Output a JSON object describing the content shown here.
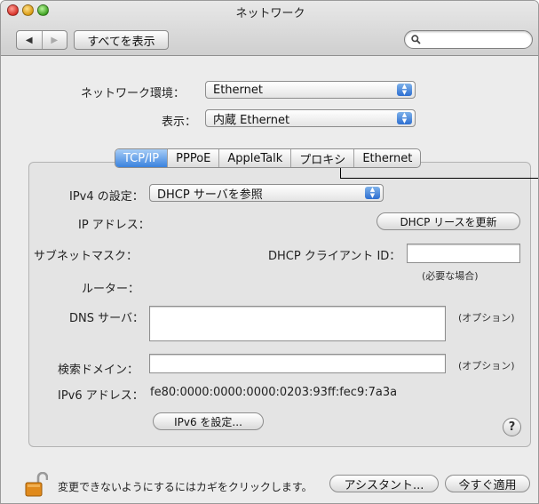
{
  "window": {
    "title": "ネットワーク"
  },
  "toolbar": {
    "back_label": "◀",
    "forward_label": "▶",
    "show_all_label": "すべてを表示",
    "search_placeholder": ""
  },
  "location": {
    "label": "ネットワーク環境：",
    "value": "Ethernet"
  },
  "show": {
    "label": "表示：",
    "value": "内蔵 Ethernet"
  },
  "tabs": [
    {
      "label": "TCP/IP",
      "selected": true
    },
    {
      "label": "PPPoE",
      "selected": false
    },
    {
      "label": "AppleTalk",
      "selected": false
    },
    {
      "label": "プロキシ",
      "selected": false
    },
    {
      "label": "Ethernet",
      "selected": false
    }
  ],
  "tcpip": {
    "ipv4_label": "IPv4 の設定：",
    "ipv4_value": "DHCP サーバを参照",
    "ip_label": "IP アドレス：",
    "renew_label": "DHCP リースを更新",
    "subnet_label": "サブネットマスク：",
    "client_id_label": "DHCP クライアント ID：",
    "client_id_value": "",
    "client_id_hint": "(必要な場合)",
    "router_label": "ルーター：",
    "dns_label": "DNS サーバ：",
    "dns_value": "",
    "dns_hint": "(オプション)",
    "search_domain_label": "検索ドメイン：",
    "search_domain_value": "",
    "search_domain_hint": "(オプション)",
    "ipv6_label": "IPv6 アドレス：",
    "ipv6_value": "fe80:0000:0000:0000:0203:93ff:fec9:7a3a",
    "ipv6_button": "IPv6 を設定...",
    "help_label": "?"
  },
  "footer": {
    "lock_text": "変更できないようにするにはカギをクリックします。",
    "assistant_label": "アシスタント...",
    "apply_label": "今すぐ適用"
  },
  "colors": {
    "tab_selected": "#3a82de",
    "popup_arrows": "#2d6fd1",
    "lock": "#e08a1c"
  }
}
